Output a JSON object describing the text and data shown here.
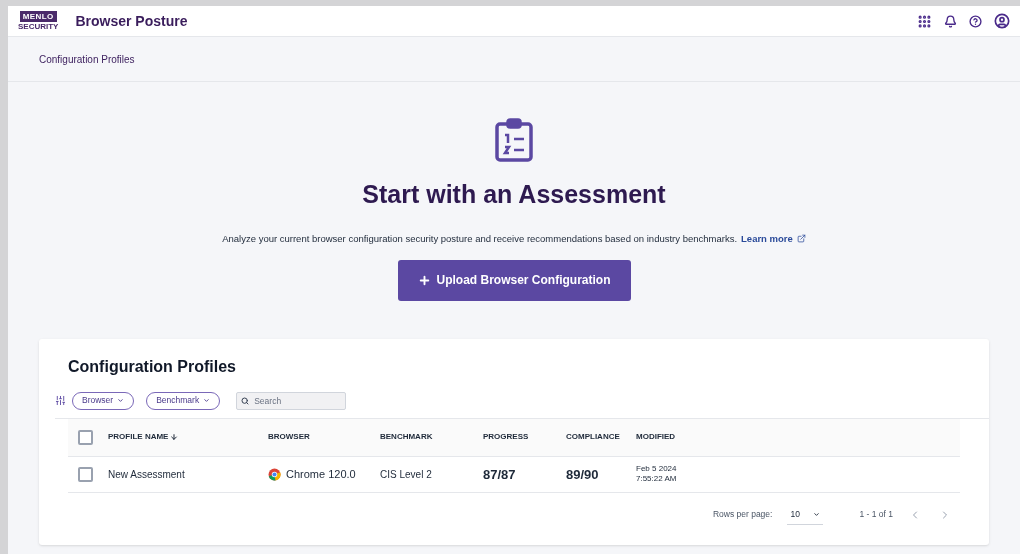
{
  "logo": {
    "top": "MENLO",
    "bottom": "SECURITY"
  },
  "app_title": "Browser Posture",
  "breadcrumb": "Configuration Profiles",
  "hero": {
    "title": "Start with an Assessment",
    "description": "Analyze your current browser configuration security posture and receive recommendations based on industry benchmarks.",
    "link": "Learn more",
    "button": "Upload Browser Configuration"
  },
  "profiles": {
    "title": "Configuration Profiles",
    "filters": [
      {
        "label": "Browser"
      },
      {
        "label": "Benchmark"
      }
    ],
    "search": {
      "placeholder": "Search"
    },
    "columns": [
      "PROFILE NAME",
      "BROWSER",
      "BENCHMARK",
      "PROGRESS",
      "COMPLIANCE",
      "MODIFIED"
    ],
    "select_all": {
      "checked": false
    },
    "rows": [
      {
        "checked": false,
        "name": "New Assessment",
        "browser": "Chrome 120.0",
        "benchmark": "CIS Level 2",
        "progress": "87/87",
        "compliance": "89/90",
        "modified_date": "Feb 5 2024",
        "modified_time": "7:55:22 AM"
      }
    ],
    "pagination": {
      "rows_label": "Rows per page:",
      "rows_value": "10",
      "range": "1 - 1 of 1"
    }
  }
}
